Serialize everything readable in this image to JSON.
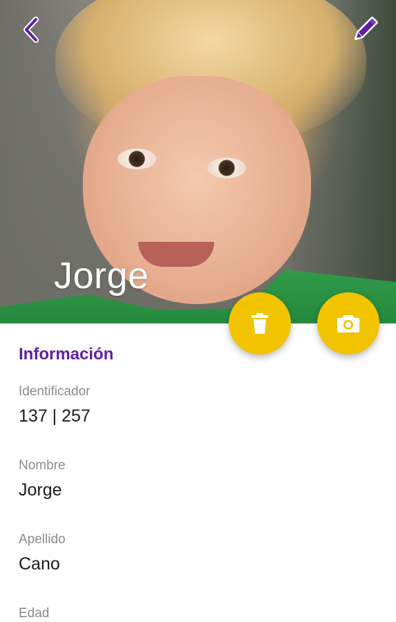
{
  "header": {
    "title": "Jorge",
    "back_icon": "chevron-left-icon",
    "edit_icon": "pencil-icon",
    "icon_color": "#5e1ea0"
  },
  "actions": {
    "delete_icon": "trash-icon",
    "camera_icon": "camera-icon",
    "fab_color": "#f2c400"
  },
  "info": {
    "section_title": "Información",
    "fields": [
      {
        "label": "Identificador",
        "value": "137 | 257"
      },
      {
        "label": "Nombre",
        "value": "Jorge"
      },
      {
        "label": "Apellido",
        "value": "Cano"
      },
      {
        "label": "Edad",
        "value": ""
      }
    ]
  }
}
